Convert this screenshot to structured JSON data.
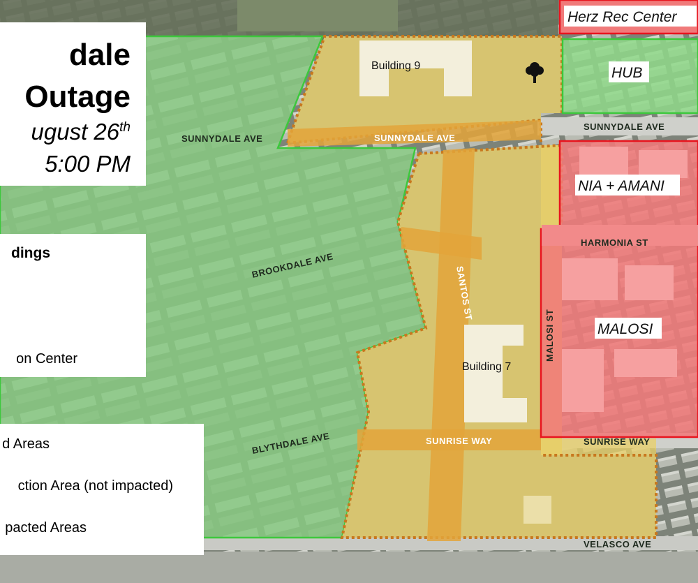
{
  "title": {
    "line1": "dale",
    "line2": "Outage",
    "date_prefix": "ugust 26",
    "date_suffix": "th",
    "time": "5:00 PM"
  },
  "buildings_panel": {
    "heading": "dings",
    "item": "on Center"
  },
  "legend": {
    "items": [
      "d Areas",
      "ction Area (not impacted)",
      "pacted Areas"
    ]
  },
  "zones": {
    "herz": "Herz Rec Center",
    "hub": "HUB",
    "nia": "NIA + AMANI",
    "malosi": "MALOSI"
  },
  "buildings": {
    "b9": "Building 9",
    "b7": "Building 7"
  },
  "streets": {
    "sunnydale_left": "SUNNYDALE AVE",
    "sunnydale_mid": "SUNNYDALE AVE",
    "sunnydale_right": "SUNNYDALE AVE",
    "brookdale": "BROOKDALE AVE",
    "blythdale": "BLYTHDALE AVE",
    "santos": "SANTOS ST",
    "sunrise_mid": "SUNRISE WAY",
    "sunrise_right": "SUNRISE WAY",
    "harmonia": "HARMONIA ST",
    "malosi_st": "MALOSI ST",
    "velasco": "VELASCO AVE"
  },
  "icons": {
    "tree": "tree-icon"
  },
  "colors": {
    "green_zone": "#8fd98a",
    "green_border": "#3cc83c",
    "yellow_zone": "#e8cf6a",
    "orange_road": "#e3a43a",
    "orange_border": "#c8781e",
    "red_zone": "#f07a7a",
    "red_border": "#e8141e"
  }
}
